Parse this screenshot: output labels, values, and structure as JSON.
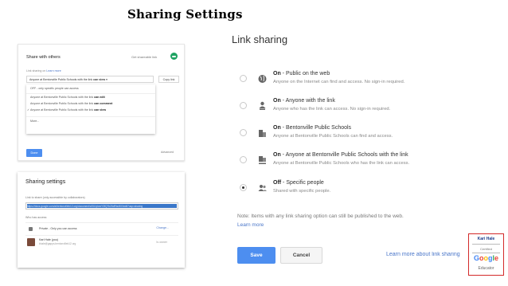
{
  "slide": {
    "title": "Sharing Settings"
  },
  "panel_share": {
    "title": "Share with others",
    "get_link": "Get shareable link",
    "link_sharing_on": "Link sharing on",
    "learn_more": "Learn more",
    "select_prefix": "Anyone at Bentonville Public Schools with the link ",
    "select_bold": "can view",
    "copy_link": "Copy link",
    "menu": [
      {
        "text": "OFF - only specific people can access",
        "bold": "",
        "checked": false
      },
      {
        "text": "Anyone at Bentonville Public Schools with the link ",
        "bold": "can edit",
        "checked": false
      },
      {
        "text": "Anyone at Bentonville Public Schools with the link ",
        "bold": "can comment",
        "checked": false
      },
      {
        "text": "Anyone at Bentonville Public Schools with the link ",
        "bold": "can view",
        "checked": true
      },
      {
        "text": "More...",
        "bold": "",
        "checked": false
      }
    ],
    "done": "Done",
    "advanced": "Advanced"
  },
  "panel_settings": {
    "title": "Sharing settings",
    "link_label": "Link to share (only accessible by collaborators)",
    "link_url": "https://docs.google.com/a/bentonvillek12.org/document/d/1IUyhexY3fQ7bZ6dRtz4K0/edit?usp=sharing",
    "who_has_access": "Who has access",
    "private_text": "Private - Only you can access",
    "change": "Change...",
    "owner_name": "Kari Hale (you)",
    "owner_email": "khale@gapps.bentonvillek12.org",
    "owner_role": "Is owner"
  },
  "link_sharing": {
    "title": "Link sharing",
    "options": [
      {
        "icon": "globe-icon",
        "bold": "On",
        "title": " - Public on the web",
        "desc": "Anyone on the Internet can find and access. No sign-in required.",
        "selected": false
      },
      {
        "icon": "person-link-icon",
        "bold": "On",
        "title": " - Anyone with the link",
        "desc": "Anyone who has the link can access. No sign-in required.",
        "selected": false
      },
      {
        "icon": "building-icon",
        "bold": "On",
        "title": " - Bentonville Public Schools",
        "desc": "Anyone at Bentonville Public Schools can find and access.",
        "selected": false
      },
      {
        "icon": "building-link-icon",
        "bold": "On",
        "title": " - Anyone at Bentonville Public Schools with the link",
        "desc": "Anyone at Bentonville Public Schools who has the link can access.",
        "selected": false
      },
      {
        "icon": "people-icon",
        "bold": "Off",
        "title": " - Specific people",
        "desc": "Shared with specific people.",
        "selected": true
      }
    ],
    "note": "Note: Items with any link sharing option can still be published to the web.",
    "learn_more": "Learn more",
    "save": "Save",
    "cancel": "Cancel",
    "learn_more_sharing": "Learn more about link sharing"
  },
  "badge": {
    "name": "Kari Hale",
    "certified": "Certified",
    "google": "Google",
    "educator": "Educator"
  },
  "colors": {
    "accent_blue": "#4d8ef0",
    "link_blue": "#4a76c9",
    "badge_red": "#d32a2a",
    "link_badge_green": "#1ea362"
  }
}
